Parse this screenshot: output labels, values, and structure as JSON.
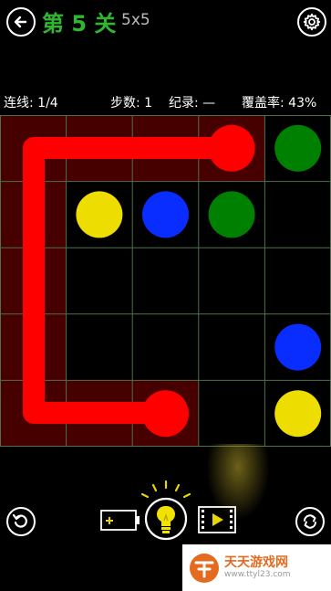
{
  "header": {
    "title": "第 5 关",
    "size": "5x5",
    "title_color": "#2fb82f",
    "back_icon": "arrow-left-icon",
    "settings_icon": "gear-icon"
  },
  "stats": {
    "links": "连线: 1/4",
    "steps": "步数: 1",
    "record": "纪录: —",
    "coverage": "覆盖率: 43%"
  },
  "board": {
    "grid_size": 5,
    "dots": [
      {
        "row": 0,
        "col": 3,
        "color": "#ff0000"
      },
      {
        "row": 0,
        "col": 4,
        "color": "#008000"
      },
      {
        "row": 1,
        "col": 1,
        "color": "#eedd00"
      },
      {
        "row": 1,
        "col": 2,
        "color": "#0a2dff"
      },
      {
        "row": 1,
        "col": 3,
        "color": "#008000"
      },
      {
        "row": 3,
        "col": 4,
        "color": "#0a2dff"
      },
      {
        "row": 4,
        "col": 2,
        "color": "#ff0000"
      },
      {
        "row": 4,
        "col": 4,
        "color": "#eedd00"
      }
    ],
    "paths": [
      {
        "color": "#ff0000",
        "cells": [
          [
            0,
            3
          ],
          [
            0,
            2
          ],
          [
            0,
            1
          ],
          [
            0,
            0
          ],
          [
            1,
            0
          ],
          [
            2,
            0
          ],
          [
            3,
            0
          ],
          [
            4,
            0
          ],
          [
            4,
            1
          ],
          [
            4,
            2
          ]
        ]
      }
    ]
  },
  "toolbar": {
    "undo_icon": "undo-icon",
    "add_hint_icon": "add-hint-battery-icon",
    "hint_icon": "lightbulb-icon",
    "video_icon": "video-play-icon",
    "restart_icon": "restart-icon"
  },
  "watermark": {
    "text": "天天游戏网",
    "url": "www.ttyl23.com"
  }
}
